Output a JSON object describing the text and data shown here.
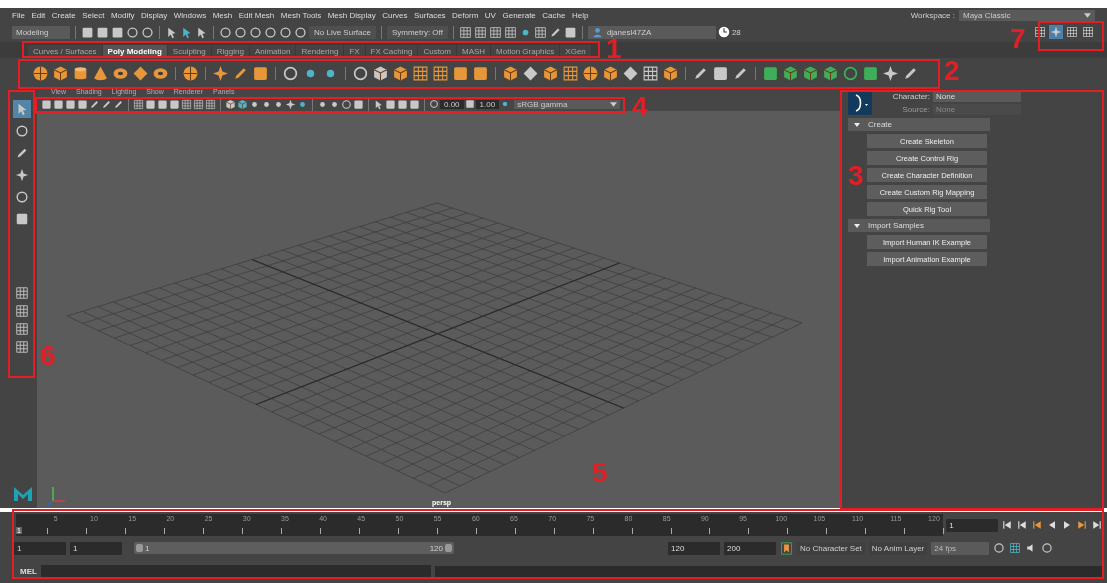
{
  "menu_bar": {
    "items": [
      "File",
      "Edit",
      "Create",
      "Select",
      "Modify",
      "Display",
      "Windows",
      "Mesh",
      "Edit Mesh",
      "Mesh Tools",
      "Mesh Display",
      "Curves",
      "Surfaces",
      "Deform",
      "UV",
      "Generate",
      "Cache",
      "Help"
    ],
    "workspace_label": "Workspace :",
    "workspace_value": "Maya Classic"
  },
  "status_line": {
    "mode": "Modeling",
    "live_surface": "No Live Surface",
    "symmetry": "Symmetry: Off",
    "user": "djanesl47ZA",
    "notifications": "28"
  },
  "panel_toggles": [
    {
      "selected": false
    },
    {
      "selected": true
    },
    {
      "selected": false
    },
    {
      "selected": false
    }
  ],
  "shelf_tabs": [
    {
      "label": "Curves / Surfaces",
      "selected": false
    },
    {
      "label": "Poly Modeling",
      "selected": true
    },
    {
      "label": "Sculpting",
      "selected": false
    },
    {
      "label": "Rigging",
      "selected": false
    },
    {
      "label": "Animation",
      "selected": false
    },
    {
      "label": "Rendering",
      "selected": false
    },
    {
      "label": "FX",
      "selected": false
    },
    {
      "label": "FX Caching",
      "selected": false
    },
    {
      "label": "Custom",
      "selected": false
    },
    {
      "label": "MASH",
      "selected": false
    },
    {
      "label": "Motion Graphics",
      "selected": false
    },
    {
      "label": "XGen",
      "selected": false
    }
  ],
  "toolbox": [
    {
      "selected": true
    },
    {
      "selected": false
    },
    {
      "selected": false
    },
    {
      "selected": false
    },
    {
      "selected": false
    },
    {
      "selected": false
    }
  ],
  "viewport": {
    "menu": [
      "View",
      "Shading",
      "Lighting",
      "Show",
      "Renderer",
      "Panels"
    ],
    "exposure": "0.00",
    "gamma": "1.00",
    "color_space": "sRGB gamma",
    "camera": "persp"
  },
  "character_panel": {
    "character_label": "Character:",
    "character_value": "None",
    "source_label": "Source:",
    "source_value": "None",
    "sections": [
      {
        "title": "Create",
        "expanded": true,
        "buttons": [
          "Create Skeleton",
          "Create Control Rig",
          "Create Character Definition",
          "Create Custom Rig Mapping",
          "Quick Rig Tool"
        ]
      },
      {
        "title": "Import Samples",
        "expanded": true,
        "buttons": [
          "Import Human IK Example",
          "Import Animation Example"
        ]
      }
    ]
  },
  "time_slider": {
    "ticks": [
      "5",
      "10",
      "15",
      "20",
      "25",
      "30",
      "35",
      "40",
      "45",
      "50",
      "55",
      "60",
      "65",
      "70",
      "75",
      "80",
      "85",
      "90",
      "95",
      "100",
      "105",
      "110",
      "115",
      "120"
    ],
    "current_marker": "1",
    "level": 0,
    "current_frame": "1"
  },
  "range_slider": {
    "start": "1",
    "playback_start": "1",
    "range_start": "1",
    "range_end": "120",
    "level": 1,
    "playback_end": "120",
    "end": "200",
    "character_set": "No Character Set",
    "anim_layer": "No Anim Layer",
    "fps": "24 fps"
  },
  "command_line": {
    "label": "MEL"
  },
  "callouts": [
    "1",
    "2",
    "3",
    "4",
    "5",
    "6",
    "7"
  ]
}
